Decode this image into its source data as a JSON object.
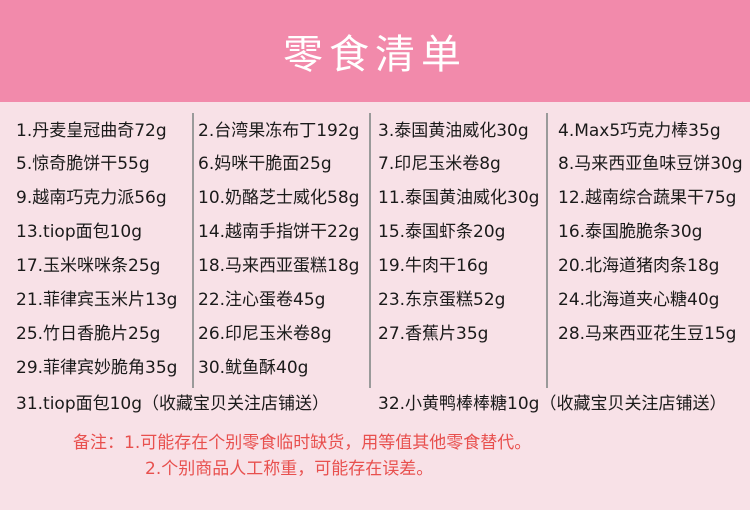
{
  "title": "零食清单",
  "items": [
    "1.丹麦皇冠曲奇72g",
    "2.台湾果冻布丁192g",
    "3.泰国黄油威化30g",
    "4.Max5巧克力棒35g",
    "5.惊奇脆饼干55g",
    "6.妈咪干脆面25g",
    "7.印尼玉米卷8g",
    "8.马来西亚鱼味豆饼30g",
    "9.越南巧克力派56g",
    "10.奶酪芝士威化58g",
    "11.泰国黄油威化30g",
    "12.越南综合蔬果干75g",
    "13.tiop面包10g",
    "14.越南手指饼干22g",
    "15.泰国虾条20g",
    "16.泰国脆脆条30g",
    "17.玉米咪咪条25g",
    "18.马来西亚蛋糕18g",
    "19.牛肉干16g",
    "20.北海道猪肉条18g",
    "21.菲律宾玉米片13g",
    "22.注心蛋卷45g",
    "23.东京蛋糕52g",
    "24.北海道夹心糖40g",
    "25.竹日香脆片25g",
    "26.印尼玉米卷8g",
    "27.香蕉片35g",
    "28.马来西亚花生豆15g",
    "29.菲律宾妙脆角35g",
    "30.鱿鱼酥40g"
  ],
  "extra_items": [
    "31.tiop面包10g（收藏宝贝关注店铺送）",
    "32.小黄鸭棒棒糖10g（收藏宝贝关注店铺送）"
  ],
  "notes": [
    "备注：1.可能存在个别零食临时缺货，用等值其他零食替代。",
    "2.个别商品人工称重，可能存在误差。"
  ]
}
